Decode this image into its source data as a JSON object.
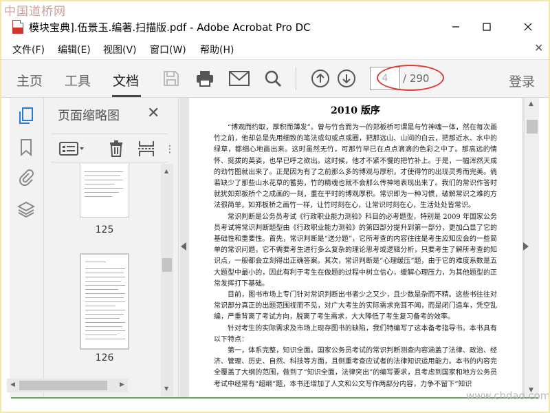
{
  "watermark": {
    "top": "中国道桥网",
    "bottom": "www.chdao.com"
  },
  "window": {
    "title": "模块宝典].伍景玉.编著.扫描版.pdf - Adobe Acrobat Pro DC"
  },
  "menu": {
    "items": [
      "文件(F)",
      "编辑(E)",
      "视图(V)",
      "窗口(W)",
      "帮助(H)"
    ]
  },
  "toolbar": {
    "tabs": [
      "主页",
      "工具",
      "文档"
    ],
    "active_tab": "文档",
    "page_current": "4",
    "page_total": "/ 290",
    "login": "登录"
  },
  "sidebar": {
    "panel_title": "页面缩略图",
    "thumbnails": [
      {
        "label": "125"
      },
      {
        "label": "126"
      }
    ]
  },
  "document": {
    "heading": "2010 版序",
    "paragraphs": [
      "“博观而约取，厚积而薄发”。曾与竹合而为一的郑板桥可谓是与竹神魂一体，然在每次画竹之前，他却总是先用细致的笔法或勾或点或圈，把那远山、山间的白云，把那近水、水中的绿草，都细心地画出来。这时虽然无竹，可那竹早已在点点滴滴的色彩之中了。那高远的情怀、挺拔的英姿，也早已呼之欲出。这时候，他才不紧不慢的把竹补上。于是，一幅浑然天成的劲竹图就出来了。正是因为有了之前那么多的博观与厚积，才使得竹的出现灵秀而完美。倘若缺少了那些山水花草的蓄势，竹的精魂也就不会那么传神地表现出来了。我们的常识作答时就犹如郑板桥个之成画的一刻，重在平时的博观厚积。常识即为一种习惯，破解常识之难的方法很简单，如郑板桥之画竹一样，让竹时刻在心，让常识时刻在心，生活处处皆常识。",
      "常识判断是公务员考试《行政职业能力测验》科目的必考题型，特别是 2009 年国家公务员考试将常识判断题型由《行政职业能力测验》的第四部分提升到第一部分，更加凸显了它的基础性和重要性。首先，常识判断是“送分题”，它所考查的内容往往是考生应知应会的一些简单的常识问题，它不需要考生进行多么复杂的理论思考或逻辑分析，只要考生了解所考查的知识点，一般都会立刻得出正确答案。其次，常识判断是“心理缓压”题，由于它的难度系数是五大题型中最小的，因此有利于考生在做题的过程中树立信心，缓解心理压力，为其他题型的正常发挥打下基础。",
      "目前，图书市场上专门针对常识判断出书者少之又少，且少数是杂而不精。这些书往往对常识部分真正的出题范围视而不见，对广大考生的实际需求充耳不闻，而是闭门造车，凭空乱编，严重背离了考试方向，脱离了考生需求，大大降低了考生复习备考的效率。",
      "针对考生的实际需求及市场上现存图书的缺陷，我们特编写了这本备考指导书。本书具有以下特点：",
      "第一，体系完整，知识全面。国家公务员考试的常识判断测查内容涵盖了法律、政治、经济、管理、历史、自然、科技等方面，且侧重考查应试者的法律知识运用能力。本书的内容完全覆盖了大纲的范围，做到了“知识全面，法律突出”的编写要求，且考虑到国家和地方公务员考试中经常有“超纲”题，本书还增加了人文和公文写作两部分内容，力争不留下“知识"
    ]
  }
}
